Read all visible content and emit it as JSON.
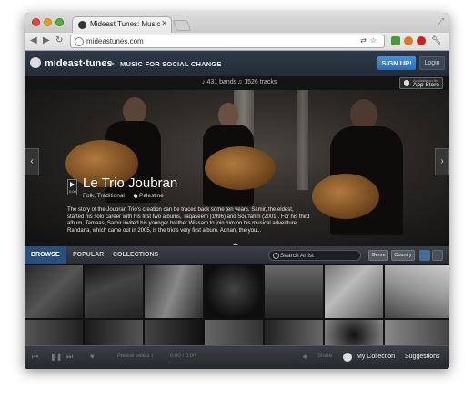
{
  "browser": {
    "tab_title": "Mideast Tunes: Music for Soc",
    "url": "mideastunes.com"
  },
  "site": {
    "logo": "mideast·tunes",
    "tagline": "MUSIC FOR SOCIAL CHANGE",
    "signup_label": "SIGN UP!",
    "login_label": "Login"
  },
  "stats": {
    "bands": "431 bands",
    "tracks": "1526 tracks",
    "appstore_small": "Available on the",
    "appstore_big": "App Store"
  },
  "featured": {
    "artist_name": "Le Trio Joubran",
    "genres": "Folk, Traditional",
    "location": "Palestine",
    "play_count": "0:00",
    "bio": "The story of the Joubran Trio's creation can be traced back some ten years. Samir, the eldest, started his solo career with his first two albums, Taqaseem (1996) and Sou'fahm (2001). For his third album, Tamaas, Samir invited his younger brother Wissam to join him on his musical adventure. Randana, which came out in 2005, is the trio's very first album. Adnan, the you..."
  },
  "browse": {
    "tabs": [
      "BROWSE",
      "POPULAR",
      "COLLECTIONS"
    ],
    "search_placeholder": "Search Artist",
    "filter_genre": "Genre",
    "filter_country": "Country"
  },
  "player": {
    "placeholder": "Please select t",
    "time": "0:00 / 0:00",
    "share": "Share",
    "my_collection": "My Collection",
    "suggestions": "Suggestions"
  },
  "colors": {
    "signup_blue": "#2a6db6",
    "active_tab": "#2a4f7c",
    "header_bg": "#2e3a47"
  }
}
